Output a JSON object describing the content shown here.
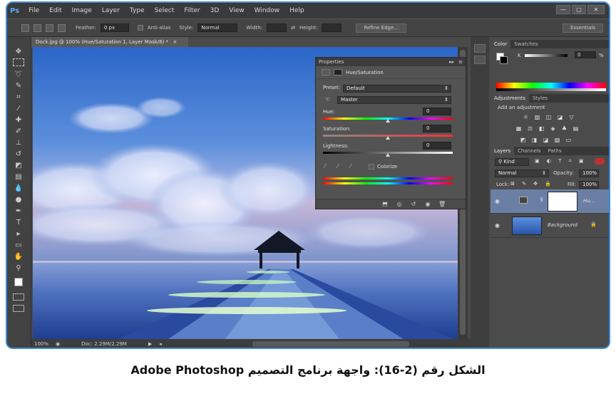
{
  "app": {
    "logo": "Ps"
  },
  "menu": [
    "File",
    "Edit",
    "Image",
    "Layer",
    "Type",
    "Select",
    "Filter",
    "3D",
    "View",
    "Window",
    "Help"
  ],
  "window_controls": {
    "minimize": "—",
    "restore": "▢",
    "close": "✕"
  },
  "options_bar": {
    "feather_label": "Feather:",
    "feather_value": "0 px",
    "antialias_label": "Anti-alias",
    "style_label": "Style:",
    "style_value": "Normal",
    "width_label": "Width:",
    "height_label": "Height:",
    "refine_edge": "Refine Edge...",
    "workspace": "Essentials"
  },
  "document": {
    "tab_title": "Dock.jpg @ 100% (Hue/Saturation 1, Layer Mask/8) *",
    "tab_close": "×",
    "zoom": "100%",
    "doc_info": "Doc: 2.29M/2.29M"
  },
  "properties": {
    "panel_title": "Properties",
    "header": "Hue/Saturation",
    "preset_label": "Preset:",
    "preset_value": "Default",
    "channel_value": "Master",
    "hue_label": "Hue:",
    "hue_value": "0",
    "hue_pos": 0.5,
    "saturation_label": "Saturation:",
    "saturation_value": "0",
    "saturation_pos": 0.5,
    "lightness_label": "Lightness:",
    "lightness_value": "0",
    "lightness_pos": 0.5,
    "colorize_label": "Colorize"
  },
  "color_panel": {
    "tabs": [
      "Color",
      "Swatches"
    ],
    "channel_label": "K",
    "value": "0",
    "unit": "%"
  },
  "adjustments_panel": {
    "tabs": [
      "Adjustments",
      "Styles"
    ],
    "heading": "Add an adjustment"
  },
  "layers_panel": {
    "tabs": [
      "Layers",
      "Channels",
      "Paths"
    ],
    "filter_label": "Kind",
    "blend_mode": "Normal",
    "opacity_label": "Opacity:",
    "opacity_value": "100%",
    "lock_label": "Lock:",
    "fill_label": "Fill:",
    "fill_value": "100%",
    "layers": [
      {
        "name": "Hu..."
      },
      {
        "name": "Background"
      }
    ]
  },
  "caption": "الشكل رقم (2-16): واجهة برنامج التصميم Adobe Photoshop",
  "colors": {
    "accent": "#3b8bd8",
    "panel": "#4b4b4b",
    "dark": "#3a3a3a"
  }
}
